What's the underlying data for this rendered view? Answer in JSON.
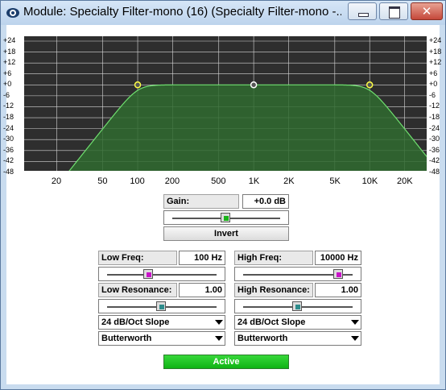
{
  "window": {
    "title": "Module: Specialty Filter-mono (16) (Specialty Filter-mono -..."
  },
  "titlebar_buttons": {
    "minimize": "minimize-icon",
    "maximize": "maximize-icon",
    "close": "close-icon"
  },
  "graph": {
    "y_labels": [
      "+24",
      "+18",
      "+12",
      "+6",
      "+0",
      "-6",
      "-12",
      "-18",
      "-24",
      "-30",
      "-36",
      "-42",
      "-48"
    ],
    "x_labels": [
      "20",
      "50",
      "100",
      "200",
      "500",
      "1K",
      "2K",
      "5K",
      "10K",
      "20K"
    ],
    "colors": {
      "background": "#2e2e2e",
      "grid": "#d8d8d8",
      "fill": "#2f6a2f",
      "curve": "#6fe06f",
      "node": "#ffff44"
    }
  },
  "gain": {
    "label": "Gain:",
    "value": "+0.0 dB",
    "slider_level": 0.5
  },
  "invert": {
    "label": "Invert"
  },
  "low": {
    "freq_label": "Low Freq:",
    "freq_value": "100 Hz",
    "freq_slider_level": 0.38,
    "res_label": "Low Resonance:",
    "res_value": "1.00",
    "res_slider_level": 0.5,
    "slope": "24 dB/Oct Slope",
    "type": "Butterworth"
  },
  "high": {
    "freq_label": "High Freq:",
    "freq_value": "10000 Hz",
    "freq_slider_level": 0.88,
    "res_label": "High Resonance:",
    "res_value": "1.00",
    "res_slider_level": 0.5,
    "slope": "24 dB/Oct Slope",
    "type": "Butterworth"
  },
  "active": {
    "label": "Active"
  }
}
